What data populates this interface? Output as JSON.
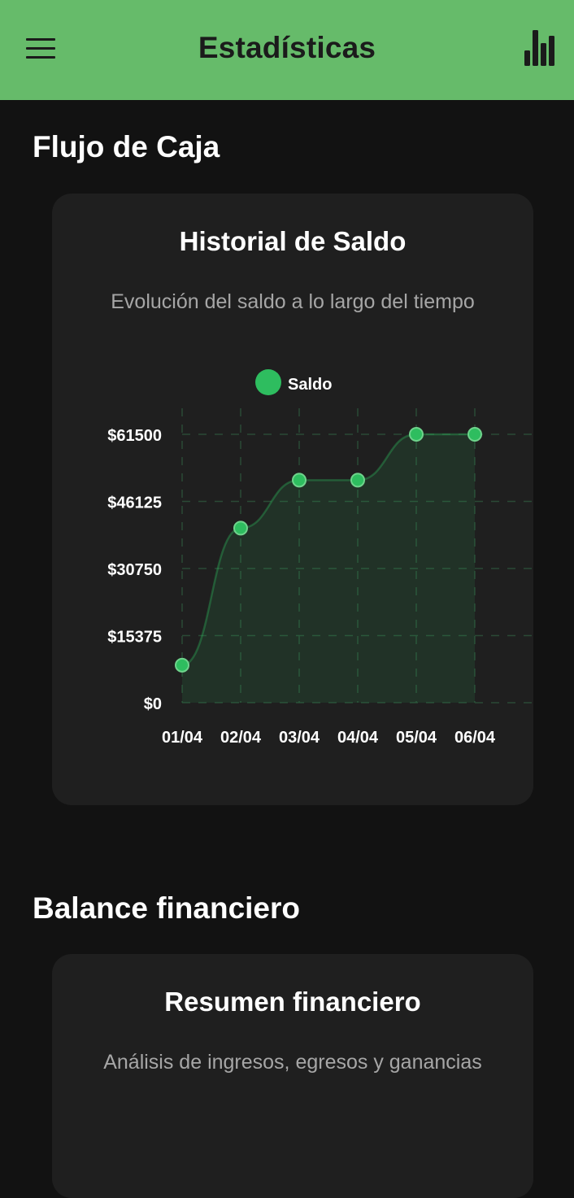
{
  "app_bar": {
    "title": "Estadísticas",
    "menu_icon": "hamburger-menu-icon",
    "action_icon": "bar-chart-icon"
  },
  "colors": {
    "app_bar": "#66bb6a",
    "background": "#121212",
    "card": "#1f1f1f",
    "series": "#2ebd5f"
  },
  "cash_flow": {
    "section_title": "Flujo de Caja",
    "card_title": "Historial de Saldo",
    "card_subtitle": "Evolución del saldo a lo largo del tiempo",
    "chart_data": {
      "type": "area",
      "title": "Historial de Saldo",
      "subtitle": "Evolución del saldo a lo largo del tiempo",
      "legend": "top",
      "grid": true,
      "categories": [
        "01/04",
        "02/04",
        "03/04",
        "04/04",
        "05/04",
        "06/04"
      ],
      "series": [
        {
          "name": "Saldo",
          "values": [
            8600,
            40000,
            51000,
            51000,
            61500,
            61500
          ]
        }
      ],
      "y_ticks": [
        "$0",
        "$15375",
        "$30750",
        "$46125",
        "$61500"
      ],
      "ylim": [
        0,
        61500
      ]
    }
  },
  "balance": {
    "section_title": "Balance financiero",
    "card_title": "Resumen financiero",
    "card_subtitle": "Análisis de ingresos, egresos y ganancias"
  }
}
